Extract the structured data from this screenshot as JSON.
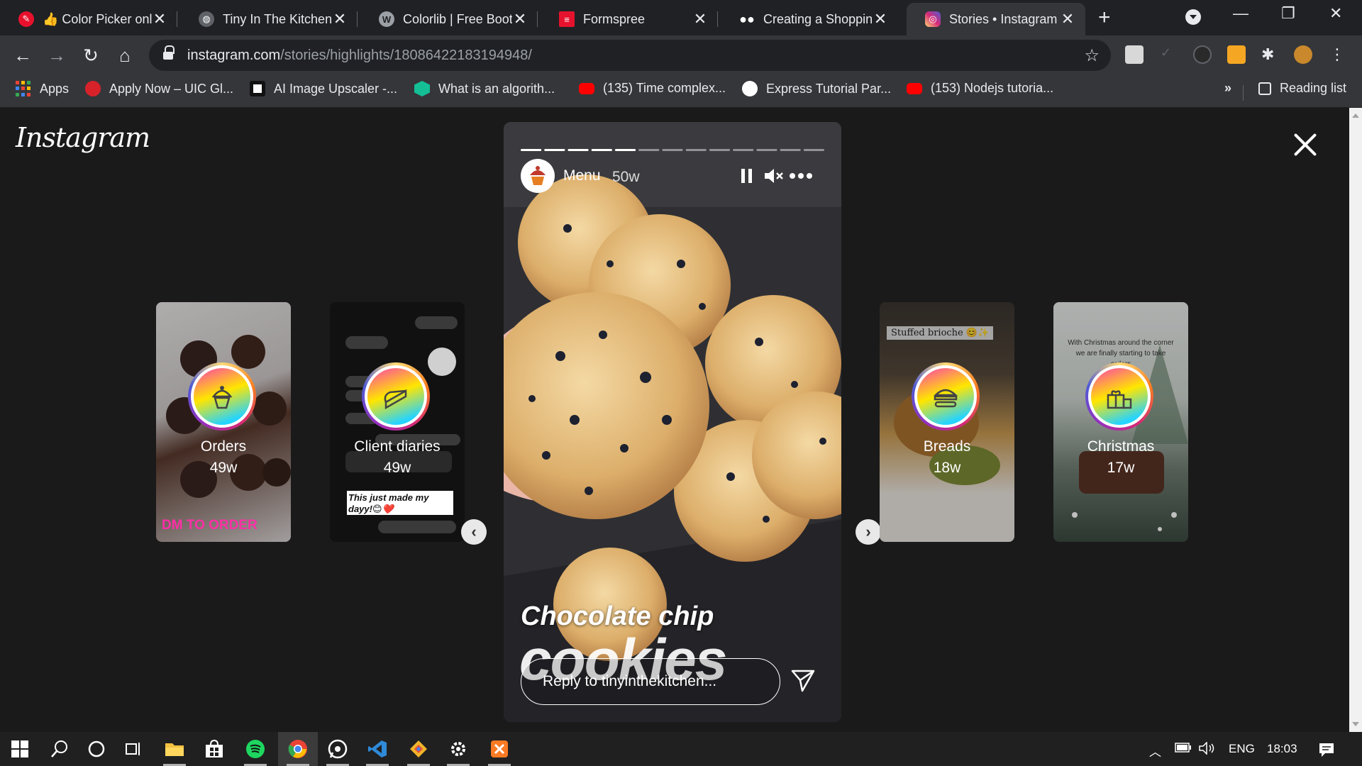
{
  "browser": {
    "tabs": [
      {
        "title": "👍 Color Picker onli",
        "favicon": "color-picker-icon",
        "color": "#e8112d"
      },
      {
        "title": "Tiny In The Kitchen",
        "favicon": "globe-icon",
        "color": "#5f6368"
      },
      {
        "title": "Colorlib | Free Boots",
        "favicon": "wordpress-icon",
        "color": "#9aa0a6"
      },
      {
        "title": "Formspree",
        "favicon": "formspree-icon",
        "color": "#e5122e"
      },
      {
        "title": "Creating a Shoppin",
        "favicon": "medium-icon",
        "color": "#ffffff"
      },
      {
        "title": "Stories • Instagram",
        "favicon": "instagram-icon",
        "color": "#d62976"
      }
    ],
    "active_tab": 5,
    "url_host": "instagram.com",
    "url_path": "/stories/highlights/18086422183194948/",
    "bookmarks": [
      {
        "label": "Apps",
        "icon": "apps-grid-icon"
      },
      {
        "label": "Apply Now – UIC Gl...",
        "icon": "uic-icon",
        "color": "#d8222a"
      },
      {
        "label": "AI Image Upscaler -...",
        "icon": "upscaler-icon",
        "color": "#ffffff"
      },
      {
        "label": "What is an algorith...",
        "icon": "khan-academy-icon",
        "color": "#14bf96"
      },
      {
        "label": "(135) Time complex...",
        "icon": "youtube-icon",
        "color": "#ff0000"
      },
      {
        "label": "Express Tutorial Par...",
        "icon": "mdn-icon",
        "color": "#ffffff"
      },
      {
        "label": "(153) Nodejs tutoria...",
        "icon": "youtube-icon",
        "color": "#ff0000"
      }
    ],
    "bookmarks_overflow": "»",
    "reading_list": "Reading list"
  },
  "instagram": {
    "logo": "Instagram",
    "previews": [
      {
        "name": "Orders",
        "date": "49w",
        "icon": "cupcake-icon",
        "caption": "DM TO ORDER"
      },
      {
        "name": "Client diaries",
        "date": "49w",
        "icon": "dessert-icon",
        "caption": "This just made my dayy!😊❤️"
      },
      {
        "name": "Breads",
        "date": "18w",
        "icon": "sandwich-icon",
        "caption": "Stuffed brioche 😊✨"
      },
      {
        "name": "Christmas",
        "date": "17w",
        "icon": "gift-icon",
        "caption": "With Christmas around the corner we are finally starting to take orders"
      }
    ],
    "story": {
      "title": "Menu",
      "time": "50w",
      "caption_line1": "Chocolate chip",
      "caption_line2": "cookies",
      "reply_placeholder": "Reply to tinyinthekitchen...",
      "progress_segments": 13,
      "progress_current": 5
    }
  },
  "taskbar": {
    "apps": [
      "windows-start-icon",
      "search-icon",
      "cortana-icon",
      "task-view-icon",
      "file-explorer-icon",
      "store-icon",
      "spotify-icon",
      "chrome-icon",
      "whatsapp-icon",
      "vscode-icon",
      "git-icon",
      "settings-icon",
      "xampp-icon"
    ],
    "language": "ENG",
    "time": "18:03"
  }
}
